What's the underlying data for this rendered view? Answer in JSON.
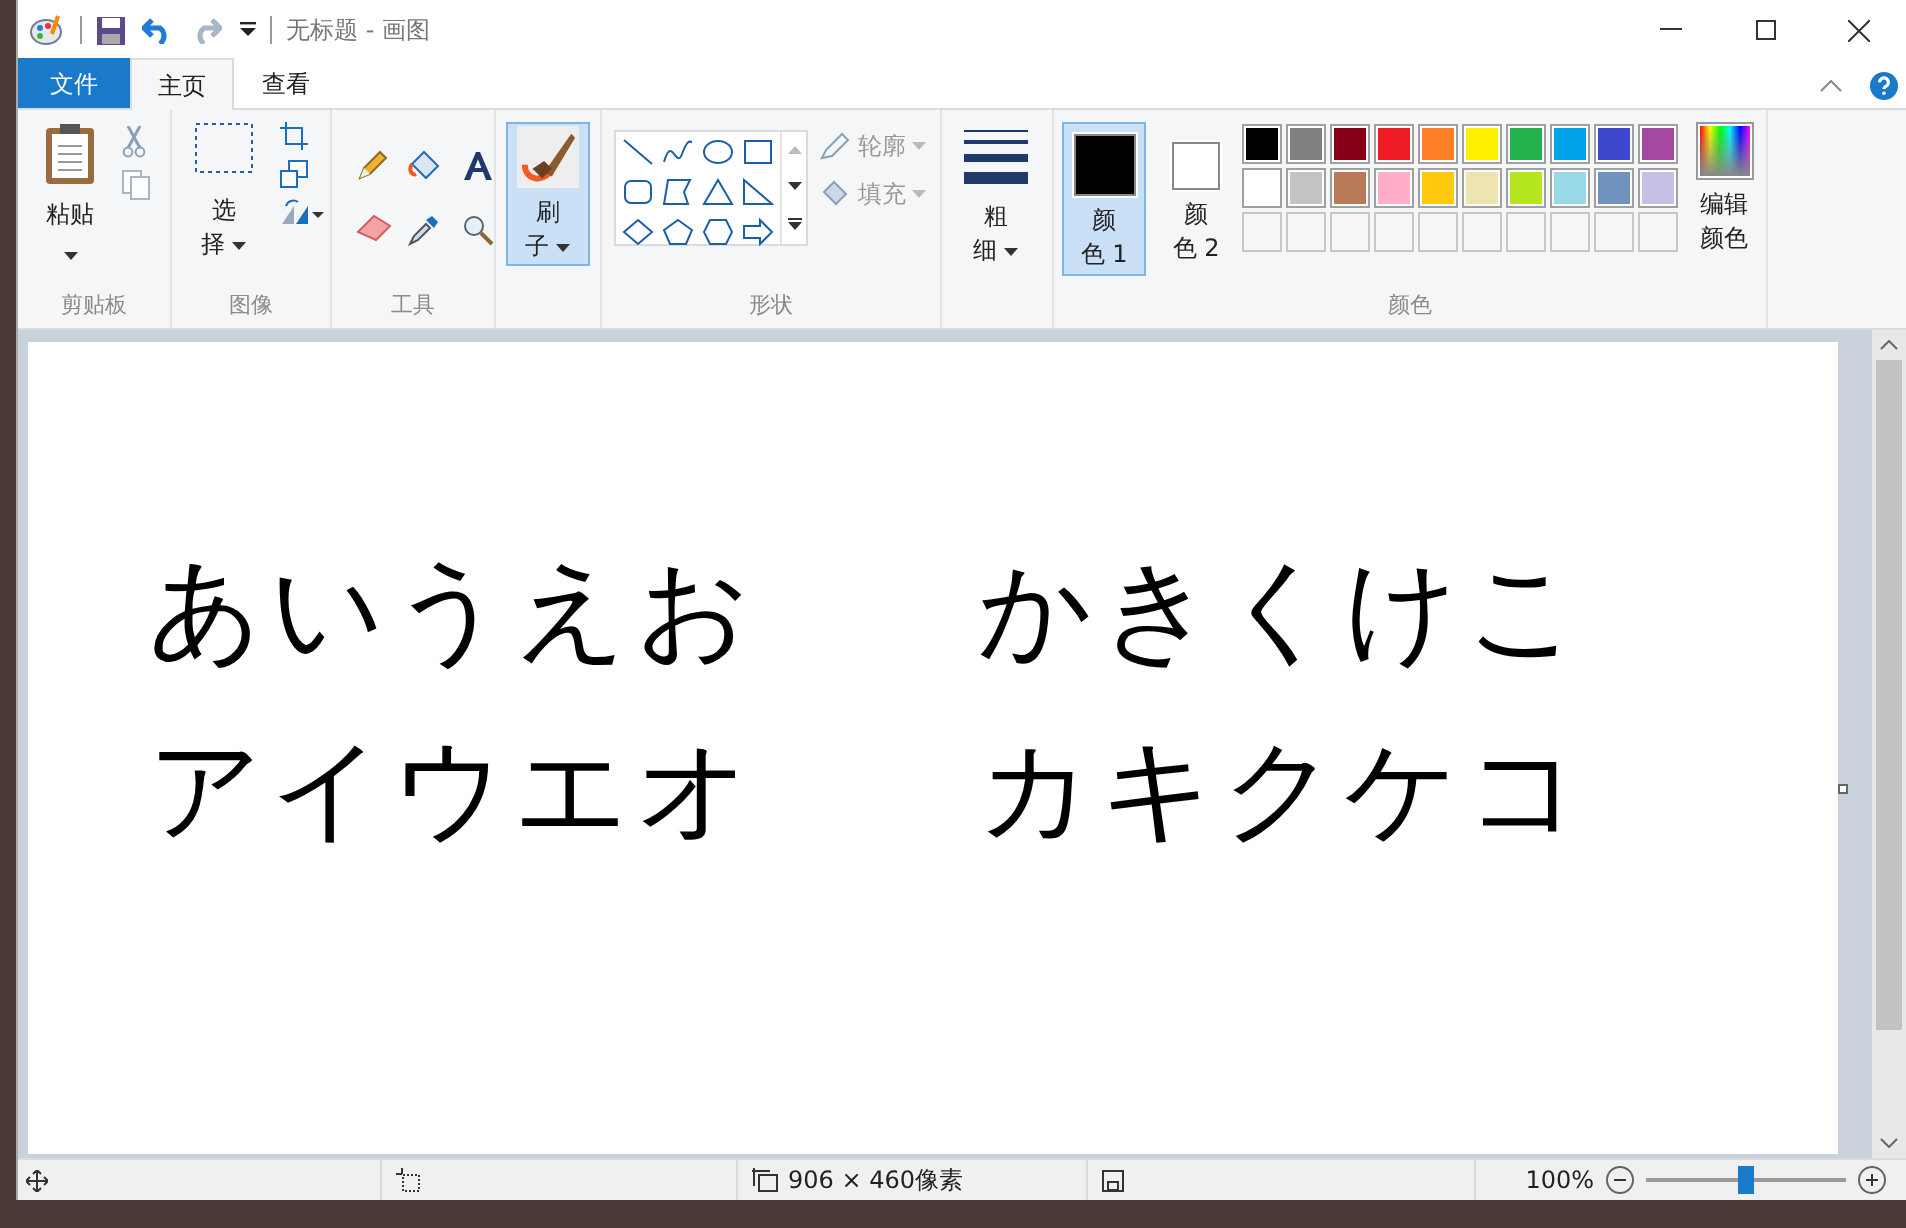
{
  "window": {
    "title": "无标题 - 画图"
  },
  "tabs": [
    {
      "label": "文件",
      "kind": "file"
    },
    {
      "label": "主页",
      "kind": "tab",
      "selected": true
    },
    {
      "label": "查看",
      "kind": "tab",
      "selected": false
    }
  ],
  "ribbon": {
    "clipboard": {
      "paste": "粘贴",
      "label": "剪贴板"
    },
    "image": {
      "select": [
        "选",
        "择"
      ],
      "label": "图像"
    },
    "tools": {
      "label": "工具"
    },
    "brushes": {
      "label": [
        "刷",
        "子"
      ],
      "selected": true
    },
    "shapes": {
      "outline": "轮廓",
      "fill": "填充",
      "label": "形状"
    },
    "size": {
      "label": [
        "粗",
        "细"
      ]
    },
    "colors": {
      "color1": {
        "label": [
          "颜",
          "色 1"
        ],
        "color": "#000000",
        "selected": true
      },
      "color2": {
        "label": [
          "颜",
          "色 2"
        ],
        "color": "#ffffff",
        "selected": false
      },
      "palette": [
        {
          "color": "#000000"
        },
        {
          "color": "#7f7f7f"
        },
        {
          "color": "#880015"
        },
        {
          "color": "#ed1c24"
        },
        {
          "color": "#ff7f27"
        },
        {
          "color": "#fff200"
        },
        {
          "color": "#22b14c"
        },
        {
          "color": "#00a2e8"
        },
        {
          "color": "#3f48cc"
        },
        {
          "color": "#a349a4"
        },
        {
          "color": "#ffffff"
        },
        {
          "color": "#c3c3c3"
        },
        {
          "color": "#b97a57"
        },
        {
          "color": "#ffaec9"
        },
        {
          "color": "#ffc90e"
        },
        {
          "color": "#efe4b0"
        },
        {
          "color": "#b5e61d"
        },
        {
          "color": "#99d9ea"
        },
        {
          "color": "#7092be"
        },
        {
          "color": "#c8bfe7"
        },
        {
          "kind": "empty"
        },
        {
          "kind": "empty"
        },
        {
          "kind": "empty"
        },
        {
          "kind": "empty"
        },
        {
          "kind": "empty"
        },
        {
          "kind": "empty"
        },
        {
          "kind": "empty"
        },
        {
          "kind": "empty"
        },
        {
          "kind": "empty"
        },
        {
          "kind": "empty"
        }
      ],
      "edit": [
        "编辑",
        "颜色"
      ],
      "label": "颜色"
    }
  },
  "canvas": {
    "lines": [
      [
        "あいうえお",
        "かきくけこ"
      ],
      [
        "アイウエオ",
        "カキクケコ"
      ]
    ]
  },
  "status_bar": {
    "size": "906 × 460像素",
    "zoom": "100%",
    "zoom_slider": {
      "level": 0.5
    }
  }
}
